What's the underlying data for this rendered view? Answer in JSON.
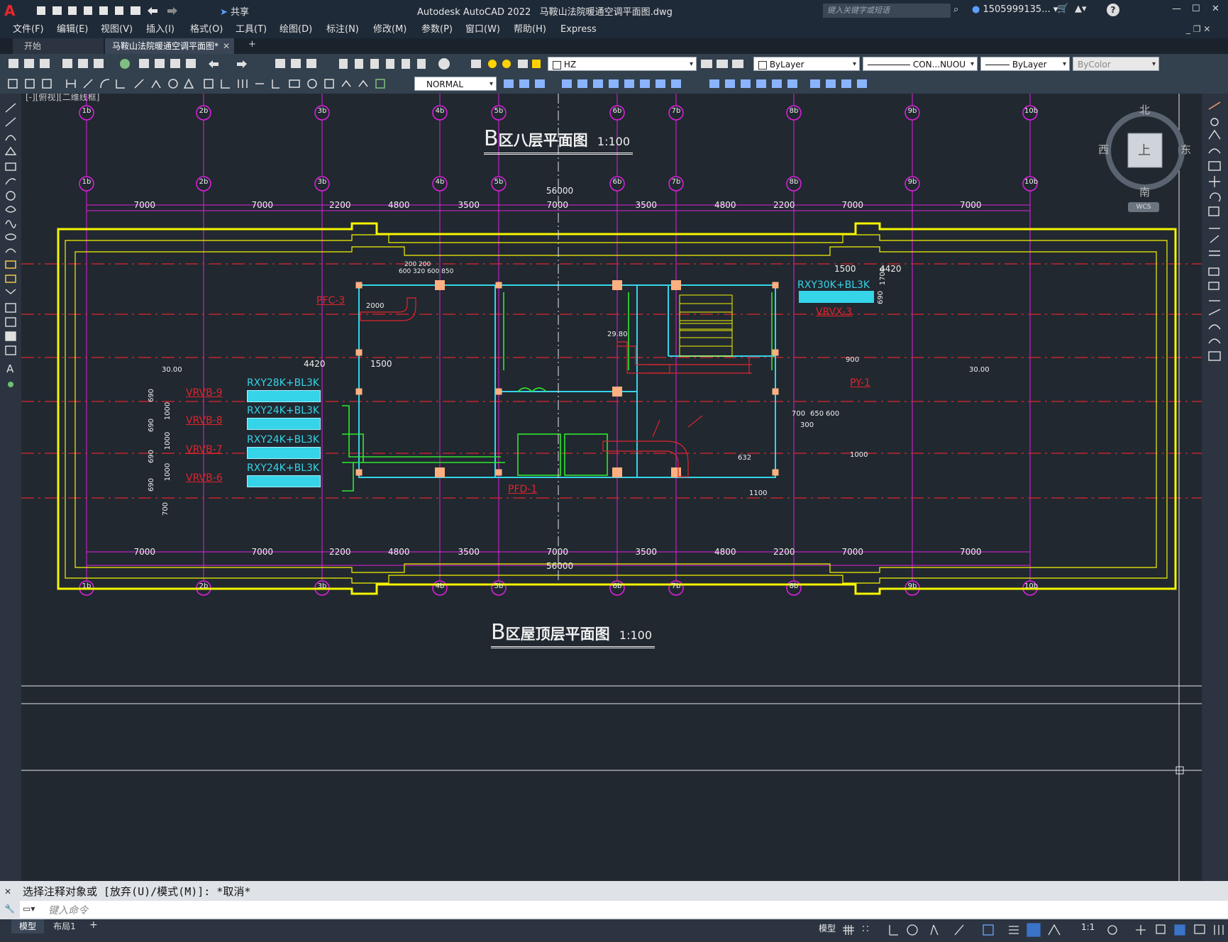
{
  "window": {
    "app_title": "Autodesk AutoCAD 2022",
    "file_title": "马鞍山法院暖通空调平面图.dwg",
    "share_label": "共享",
    "search_placeholder": "键入关键字或短语",
    "user": "1505999135...",
    "help": "?",
    "minimize": "—",
    "maximize": "☐",
    "close": "✕"
  },
  "menu": [
    "文件(F)",
    "编辑(E)",
    "视图(V)",
    "插入(I)",
    "格式(O)",
    "工具(T)",
    "绘图(D)",
    "标注(N)",
    "修改(M)",
    "参数(P)",
    "窗口(W)",
    "帮助(H)",
    "Express"
  ],
  "tabs": {
    "start": "开始",
    "file": "马鞍山法院暖通空调平面图*",
    "add": "+"
  },
  "ribbon": {
    "layer": "HZ",
    "color": "ByLayer",
    "linetype": "CON...NUOU",
    "lineweight": "ByLayer",
    "plotstyle": "ByColor",
    "dimstyle": "NORMAL"
  },
  "viewport_label": "[-][俯视][二维线框]",
  "viewcube": {
    "north": "北",
    "south": "南",
    "east": "东",
    "west": "西",
    "top": "上",
    "wcs": "WCS"
  },
  "drawing": {
    "title_top": "区八层平面图",
    "title_top_letter": "B",
    "title_bottom": "区屋顶层平面图",
    "title_bottom_letter": "B",
    "scale": "1:100",
    "total_dim": "56000",
    "axes": [
      "1b",
      "2b",
      "3b",
      "4b",
      "5b",
      "6b",
      "7b",
      "8b",
      "9b",
      "10b"
    ],
    "spans": [
      "7000",
      "7000",
      "2200",
      "4800",
      "3500",
      "7000",
      "3500",
      "4800",
      "2200",
      "7000",
      "7000"
    ],
    "units_left": [
      {
        "model": "RXY28K+BL3K",
        "tag": "VRVB-9"
      },
      {
        "model": "RXY24K+BL3K",
        "tag": "VRVB-8"
      },
      {
        "model": "RXY24K+BL3K",
        "tag": "VRVB-7"
      },
      {
        "model": "RXY24K+BL3K",
        "tag": "VRVB-6"
      }
    ],
    "unit_right": {
      "model": "RXY30K+BL3K",
      "tag": "VRVX-3"
    },
    "dims_left": [
      "4420",
      "1500"
    ],
    "dims_right": [
      "1500",
      "4420"
    ],
    "dims_vert_left": [
      "690",
      "1000",
      "690",
      "1000",
      "690",
      "1000",
      "690",
      "700"
    ],
    "dims_vert_right": [
      "1700",
      "690"
    ],
    "misc_labels": [
      "PFC-3",
      "PFD-1",
      "PY-1",
      "2000",
      "900",
      "1000",
      "1100",
      "700",
      "650",
      "600",
      "300",
      "632",
      "29.80",
      "30.00",
      "200 200",
      "600 320 600 850"
    ]
  },
  "command": {
    "history": "选择注释对象或 [放弃(U)/模式(M)]: *取消*",
    "placeholder": "键入命令"
  },
  "status": {
    "model_tab": "模型",
    "layout_tab": "布局1",
    "add": "+",
    "model_btn": "模型",
    "scale": "1:1"
  }
}
